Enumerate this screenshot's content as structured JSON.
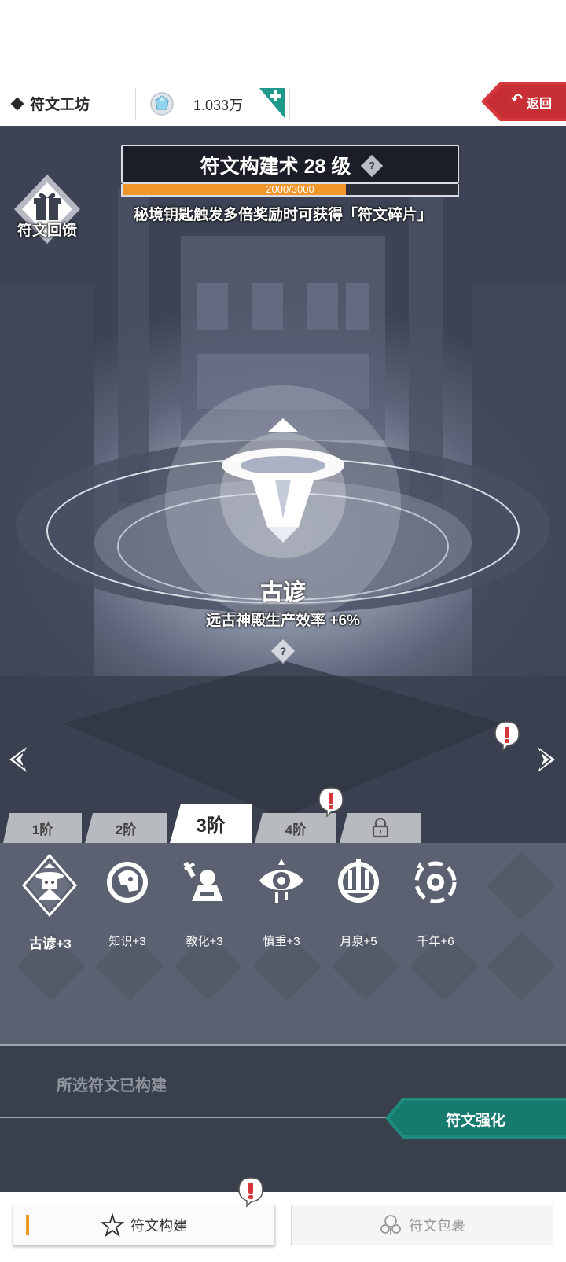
{
  "header": {
    "title": "符文工坊",
    "currency_value": "1.033万",
    "back_label": "返回"
  },
  "level": {
    "title": "符文构建术 28 级",
    "help_glyph": "?",
    "progress_text": "2000/3000",
    "progress_fraction": 0.667
  },
  "hint": "秘境钥匙触发多倍奖励时可获得「符文碎片」",
  "feedback_label": "符文回馈",
  "rune": {
    "name": "古谚",
    "effect": "远古神殿生产效率 +6%",
    "help_glyph": "?"
  },
  "alert_glyph": "!",
  "tabs": [
    {
      "label": "1阶",
      "active": false
    },
    {
      "label": "2阶",
      "active": false
    },
    {
      "label": "3阶",
      "active": true
    },
    {
      "label": "4阶",
      "active": false
    },
    {
      "label": "",
      "locked": true
    }
  ],
  "runes": [
    {
      "label": "古谚+3",
      "selected": true,
      "icon": "priest-icon"
    },
    {
      "label": "知识+3",
      "selected": false,
      "icon": "knowledge-icon"
    },
    {
      "label": "教化+3",
      "selected": false,
      "icon": "doctrine-icon"
    },
    {
      "label": "慎重+3",
      "selected": false,
      "icon": "eye-icon"
    },
    {
      "label": "月泉+5",
      "selected": false,
      "icon": "moon-spring-icon"
    },
    {
      "label": "千年+6",
      "selected": false,
      "icon": "millennium-icon"
    }
  ],
  "status": {
    "text": "所选符文已构建",
    "enhance_label": "符文强化"
  },
  "bottom_nav": {
    "build_label": "符文构建",
    "bag_label": "符文包裹"
  },
  "colors": {
    "accent_orange": "#f0962a",
    "teal": "#1f8b7e",
    "back_red": "#d6373c"
  }
}
